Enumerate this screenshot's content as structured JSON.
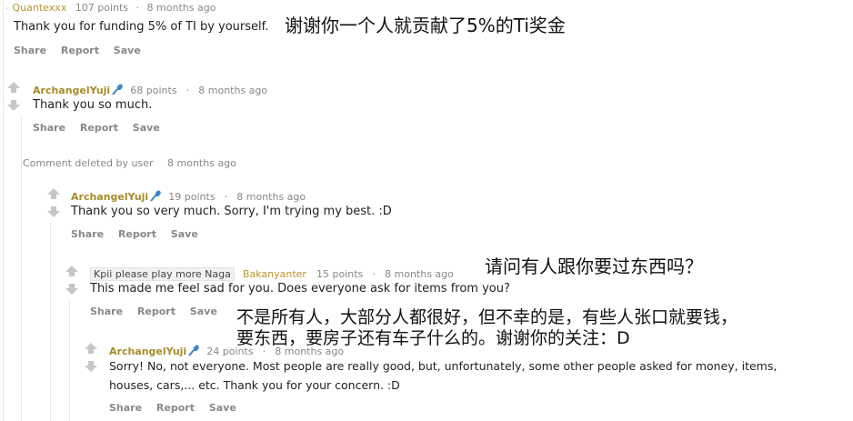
{
  "comment1": {
    "author": "Quantexxx",
    "points": "107 points",
    "sep": "·",
    "time": "8 months ago",
    "body": "Thank you for funding 5% of TI by yourself.",
    "actions": [
      "Share",
      "Report",
      "Save"
    ]
  },
  "comment2": {
    "author": "ArchangelYuji",
    "points": "68 points",
    "sep": "·",
    "time": "8 months ago",
    "body": "Thank you so much.",
    "actions": [
      "Share",
      "Report",
      "Save"
    ]
  },
  "deleted": {
    "label": "Comment deleted by user",
    "time": "8 months ago"
  },
  "comment3": {
    "author": "ArchangelYuji",
    "points": "19 points",
    "sep": "·",
    "time": "8 months ago",
    "body": "Thank you so very much. Sorry, I'm trying my best. :D",
    "actions": [
      "Share",
      "Report",
      "Save"
    ]
  },
  "comment4": {
    "flair": "Kpii please play more Naga",
    "author": "Bakanyanter",
    "points": "15 points",
    "sep": "·",
    "time": "8 months ago",
    "body": "This made me feel sad for you. Does everyone ask for items from you?",
    "actions": [
      "Share",
      "Report",
      "Save"
    ]
  },
  "comment5": {
    "author": "ArchangelYuji",
    "points": "24 points",
    "sep": "·",
    "time": "8 months ago",
    "body_line1": "Sorry! No, not everyone. Most people are really good, but, unfortunately, some other people asked for money, items,",
    "body_line2": "houses, cars,... etc. Thank you for your concern. :D",
    "actions": [
      "Share",
      "Report",
      "Save"
    ]
  },
  "translations": {
    "t1": "谢谢你一个人就贡献了5%的Ti奖金",
    "t2": "请问有人跟你要过东西吗？",
    "t3_line1": "不是所有人，大部分人都很好，但不幸的是，有些人张口就要钱，",
    "t3_line2": "要东西，要房子还有车子什么的。谢谢你的关注：D"
  },
  "colors": {
    "author": "#a58c2a",
    "mic_icon": "#3d86c6",
    "meta": "#888888",
    "vote_arrow": "#c6c6c6"
  }
}
